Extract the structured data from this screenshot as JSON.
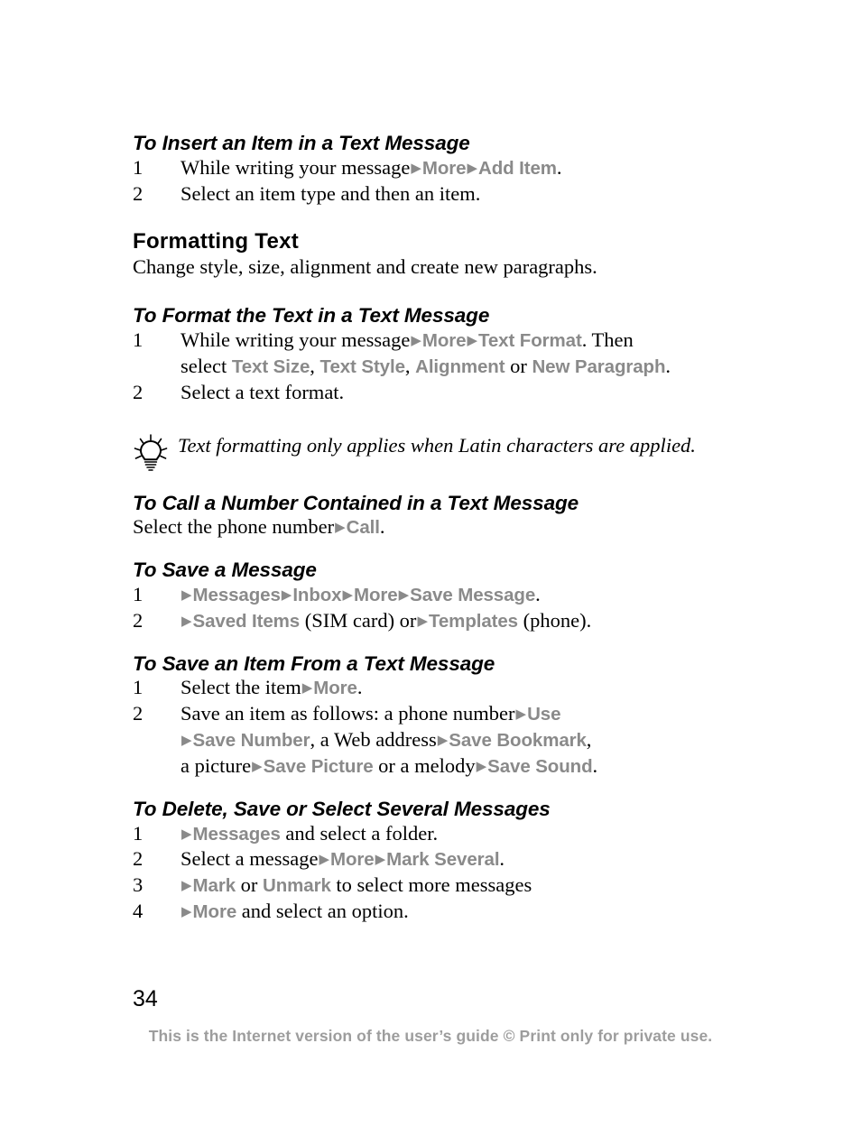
{
  "document": {
    "page_number": "34",
    "footer_note": "This is the Internet version of the user’s guide © Print only for private use.",
    "ui_term_color": "#8a8a8a",
    "footer_color": "#9d9d9d",
    "body_color": "#000000"
  },
  "sections": {
    "insert_item": {
      "heading": "To Insert an Item in a Text Message",
      "step1_num": "1",
      "step1_a": "While writing your message",
      "step1_arrow1": "▶",
      "step1_ui1": "More",
      "step1_arrow2": "▶",
      "step1_ui2": "Add Item",
      "step1_end": ".",
      "step2_num": "2",
      "step2_text": "Select an item type and then an item."
    },
    "formatting_text": {
      "heading": "Formatting Text",
      "intro": "Change style, size, alignment and create new paragraphs."
    },
    "format_text": {
      "heading": "To Format the Text in a Text Message",
      "step1_num": "1",
      "step1_a": "While writing your message",
      "step1_arrow1": "▶",
      "step1_ui1": "More",
      "step1_arrow2": "▶",
      "step1_ui2": "Text Format",
      "step1_b": ". Then",
      "step1_c": "select",
      "step1_ui3": "Text Size",
      "step1_sep1": ",",
      "step1_ui4": "Text Style",
      "step1_sep2": ",",
      "step1_ui5": "Alignment",
      "step1_or": "or",
      "step1_ui6": "New Paragraph",
      "step1_end": ".",
      "step2_num": "2",
      "step2_text": "Select a text format."
    },
    "tip": {
      "icon": "lightbulb-icon",
      "text": "Text formatting only applies when Latin characters are applied."
    },
    "call_number": {
      "heading": "To Call a Number Contained in a Text Message",
      "line_a": "Select the phone number",
      "arrow1": "▶",
      "ui1": "Call",
      "line_end": "."
    },
    "save_message": {
      "heading": "To Save a Message",
      "step1_num": "1",
      "step1_arrow1": "▶",
      "step1_ui1": "Messages",
      "step1_arrow2": "▶",
      "step1_ui2": "Inbox",
      "step1_arrow3": "▶",
      "step1_ui3": "More",
      "step1_arrow4": "▶",
      "step1_ui4": "Save Message",
      "step1_end": ".",
      "step2_num": "2",
      "step2_arrow1": "▶",
      "step2_ui1": "Saved Items",
      "step2_a": "(SIM card) or",
      "step2_arrow2": "▶",
      "step2_ui2": "Templates",
      "step2_b": "(phone)."
    },
    "save_item": {
      "heading": "To Save an Item From a Text Message",
      "step1_num": "1",
      "step1_a": "Select the item",
      "step1_arrow1": "▶",
      "step1_ui1": "More",
      "step1_end": ".",
      "step2_num": "2",
      "step2_a": "Save an item as follows: a phone number",
      "step2_arrow1": "▶",
      "step2_ui1": "Use",
      "step2_arrow2": "▶",
      "step2_ui2": "Save Number",
      "step2_sep1": ", a Web address",
      "step2_arrow3": "▶",
      "step2_ui3": "Save Bookmark",
      "step2_sep2": ",",
      "step2_b": "a picture",
      "step2_arrow4": "▶",
      "step2_ui4": "Save Picture",
      "step2_c": "or a melody",
      "step2_arrow5": "▶",
      "step2_ui5": "Save Sound",
      "step2_end": "."
    },
    "delete_save_select": {
      "heading": "To Delete, Save or Select Several Messages",
      "step1_num": "1",
      "step1_arrow1": "▶",
      "step1_ui1": "Messages",
      "step1_a": "and select a folder.",
      "step2_num": "2",
      "step2_a": "Select a message",
      "step2_arrow1": "▶",
      "step2_ui1": "More",
      "step2_arrow2": "▶",
      "step2_ui2": "Mark Several",
      "step2_end": ".",
      "step3_num": "3",
      "step3_arrow1": "▶",
      "step3_ui1": "Mark",
      "step3_or": "or",
      "step3_ui2": "Unmark",
      "step3_a": "to select more messages",
      "step4_num": "4",
      "step4_arrow1": "▶",
      "step4_ui1": "More",
      "step4_a": "and select an option."
    }
  }
}
